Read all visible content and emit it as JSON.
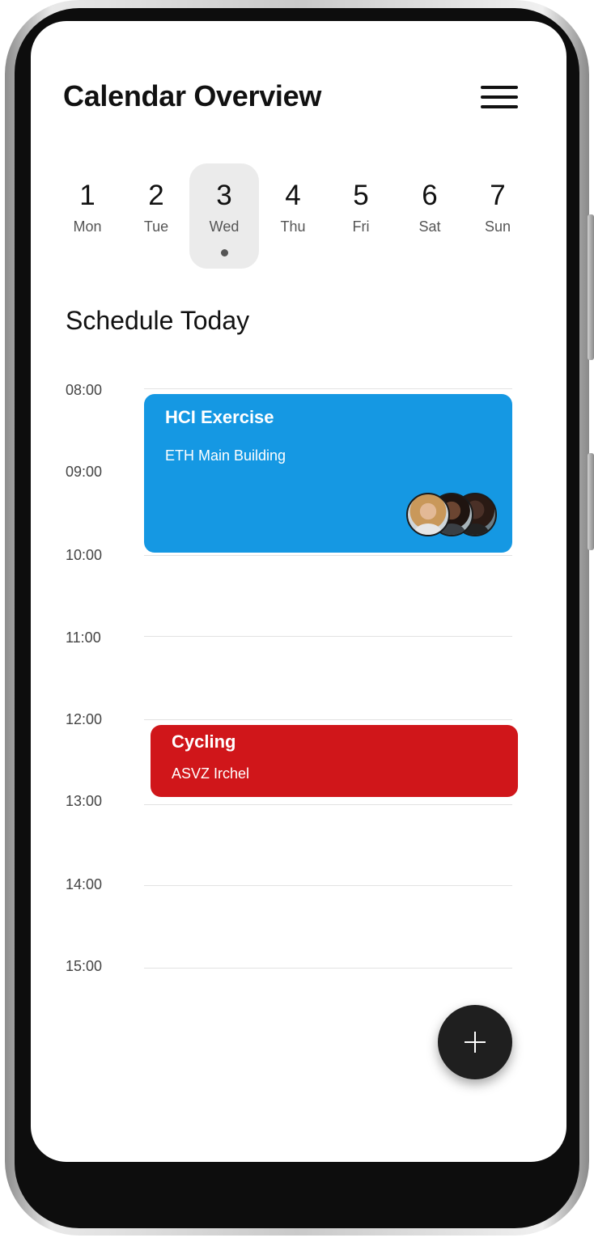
{
  "header": {
    "title": "Calendar Overview",
    "menu_icon": "hamburger-menu-icon"
  },
  "days": [
    {
      "num": "1",
      "name": "Mon",
      "selected": false
    },
    {
      "num": "2",
      "name": "Tue",
      "selected": false
    },
    {
      "num": "3",
      "name": "Wed",
      "selected": true
    },
    {
      "num": "4",
      "name": "Thu",
      "selected": false
    },
    {
      "num": "5",
      "name": "Fri",
      "selected": false
    },
    {
      "num": "6",
      "name": "Sat",
      "selected": false
    },
    {
      "num": "7",
      "name": "Sun",
      "selected": false
    }
  ],
  "schedule": {
    "title": "Schedule Today",
    "times": [
      "08:00",
      "09:00",
      "10:00",
      "11:00",
      "12:00",
      "13:00",
      "14:00",
      "15:00"
    ],
    "events": [
      {
        "title": "HCI Exercise",
        "location": "ETH Main Building",
        "start": "08:00",
        "end": "10:00",
        "color": "#1598e3",
        "participants": 3
      },
      {
        "title": "Cycling",
        "location": "ASVZ Irchel",
        "start": "12:00",
        "end": "13:00",
        "color": "#d0161a"
      }
    ]
  },
  "fab": {
    "icon": "plus-icon"
  },
  "colors": {
    "selected_day_bg": "#ebebeb",
    "fab_bg": "#1f1f1f"
  }
}
